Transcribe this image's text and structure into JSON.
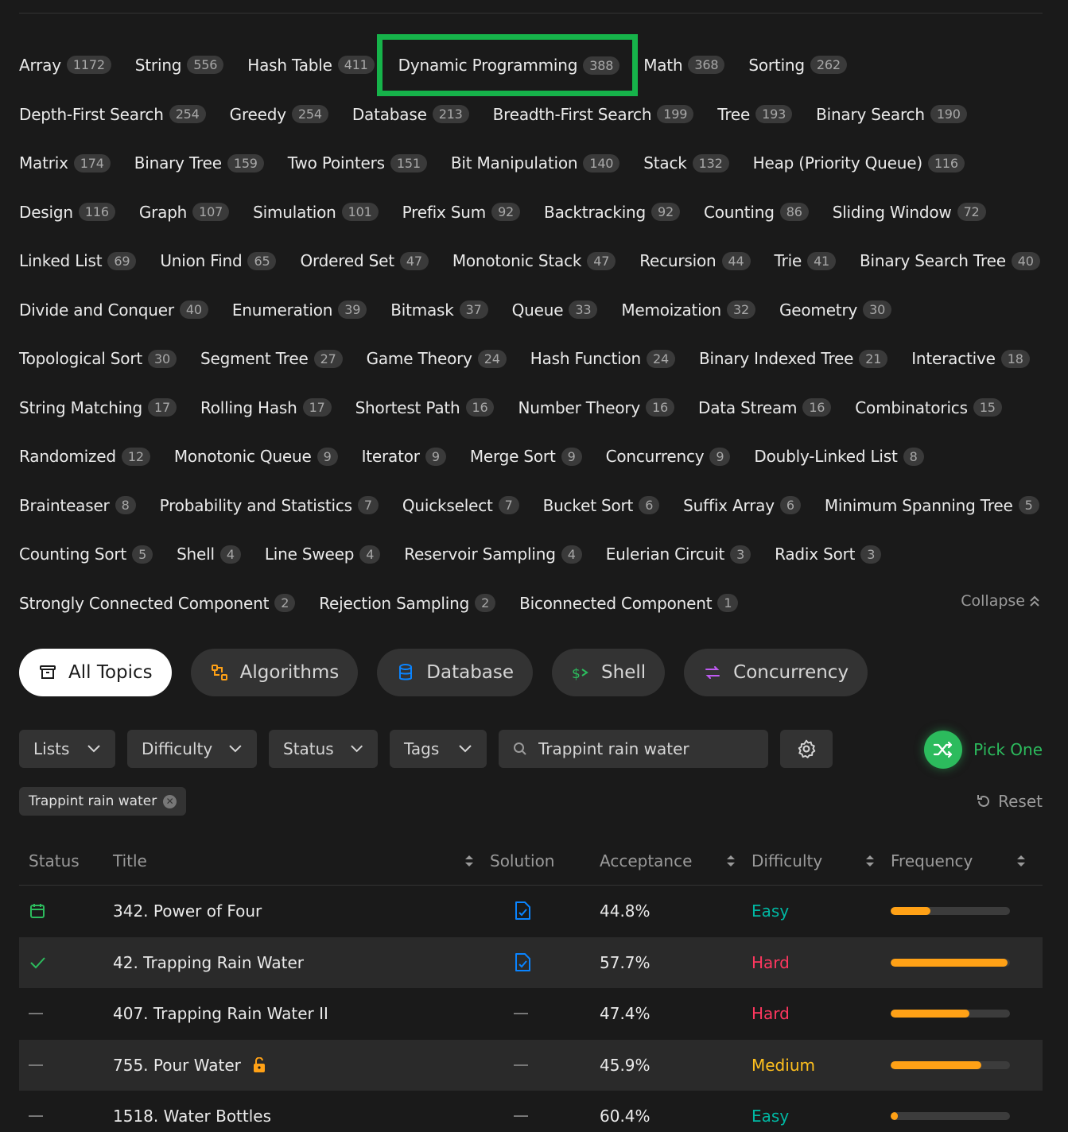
{
  "topics": [
    {
      "name": "Array",
      "count": "1172"
    },
    {
      "name": "String",
      "count": "556"
    },
    {
      "name": "Hash Table",
      "count": "411"
    },
    {
      "name": "Dynamic Programming",
      "count": "388",
      "highlighted": true
    },
    {
      "name": "Math",
      "count": "368"
    },
    {
      "name": "Sorting",
      "count": "262"
    },
    {
      "name": "Depth-First Search",
      "count": "254"
    },
    {
      "name": "Greedy",
      "count": "254"
    },
    {
      "name": "Database",
      "count": "213"
    },
    {
      "name": "Breadth-First Search",
      "count": "199"
    },
    {
      "name": "Tree",
      "count": "193"
    },
    {
      "name": "Binary Search",
      "count": "190"
    },
    {
      "name": "Matrix",
      "count": "174"
    },
    {
      "name": "Binary Tree",
      "count": "159"
    },
    {
      "name": "Two Pointers",
      "count": "151"
    },
    {
      "name": "Bit Manipulation",
      "count": "140"
    },
    {
      "name": "Stack",
      "count": "132"
    },
    {
      "name": "Heap (Priority Queue)",
      "count": "116"
    },
    {
      "name": "Design",
      "count": "116"
    },
    {
      "name": "Graph",
      "count": "107"
    },
    {
      "name": "Simulation",
      "count": "101"
    },
    {
      "name": "Prefix Sum",
      "count": "92"
    },
    {
      "name": "Backtracking",
      "count": "92"
    },
    {
      "name": "Counting",
      "count": "86"
    },
    {
      "name": "Sliding Window",
      "count": "72"
    },
    {
      "name": "Linked List",
      "count": "69"
    },
    {
      "name": "Union Find",
      "count": "65"
    },
    {
      "name": "Ordered Set",
      "count": "47"
    },
    {
      "name": "Monotonic Stack",
      "count": "47"
    },
    {
      "name": "Recursion",
      "count": "44"
    },
    {
      "name": "Trie",
      "count": "41"
    },
    {
      "name": "Binary Search Tree",
      "count": "40"
    },
    {
      "name": "Divide and Conquer",
      "count": "40"
    },
    {
      "name": "Enumeration",
      "count": "39"
    },
    {
      "name": "Bitmask",
      "count": "37"
    },
    {
      "name": "Queue",
      "count": "33"
    },
    {
      "name": "Memoization",
      "count": "32"
    },
    {
      "name": "Geometry",
      "count": "30"
    },
    {
      "name": "Topological Sort",
      "count": "30"
    },
    {
      "name": "Segment Tree",
      "count": "27"
    },
    {
      "name": "Game Theory",
      "count": "24"
    },
    {
      "name": "Hash Function",
      "count": "24"
    },
    {
      "name": "Binary Indexed Tree",
      "count": "21"
    },
    {
      "name": "Interactive",
      "count": "18"
    },
    {
      "name": "String Matching",
      "count": "17"
    },
    {
      "name": "Rolling Hash",
      "count": "17"
    },
    {
      "name": "Shortest Path",
      "count": "16"
    },
    {
      "name": "Number Theory",
      "count": "16"
    },
    {
      "name": "Data Stream",
      "count": "16"
    },
    {
      "name": "Combinatorics",
      "count": "15"
    },
    {
      "name": "Randomized",
      "count": "12"
    },
    {
      "name": "Monotonic Queue",
      "count": "9"
    },
    {
      "name": "Iterator",
      "count": "9"
    },
    {
      "name": "Merge Sort",
      "count": "9"
    },
    {
      "name": "Concurrency",
      "count": "9"
    },
    {
      "name": "Doubly-Linked List",
      "count": "8"
    },
    {
      "name": "Brainteaser",
      "count": "8"
    },
    {
      "name": "Probability and Statistics",
      "count": "7"
    },
    {
      "name": "Quickselect",
      "count": "7"
    },
    {
      "name": "Bucket Sort",
      "count": "6"
    },
    {
      "name": "Suffix Array",
      "count": "6"
    },
    {
      "name": "Minimum Spanning Tree",
      "count": "5"
    },
    {
      "name": "Counting Sort",
      "count": "5"
    },
    {
      "name": "Shell",
      "count": "4"
    },
    {
      "name": "Line Sweep",
      "count": "4"
    },
    {
      "name": "Reservoir Sampling",
      "count": "4"
    },
    {
      "name": "Eulerian Circuit",
      "count": "3"
    },
    {
      "name": "Radix Sort",
      "count": "3"
    },
    {
      "name": "Strongly Connected Component",
      "count": "2"
    },
    {
      "name": "Rejection Sampling",
      "count": "2"
    },
    {
      "name": "Biconnected Component",
      "count": "1"
    }
  ],
  "collapse_label": "Collapse",
  "categories": [
    {
      "label": "All Topics",
      "icon": "archive-icon",
      "active": true
    },
    {
      "label": "Algorithms",
      "icon": "algorithm-icon",
      "color": "#ffa116"
    },
    {
      "label": "Database",
      "icon": "database-icon",
      "color": "#0a84ff"
    },
    {
      "label": "Shell",
      "icon": "terminal-icon",
      "color": "#2cbb5d"
    },
    {
      "label": "Concurrency",
      "icon": "concurrency-icon",
      "color": "#bf5af2"
    }
  ],
  "filters": {
    "lists": "Lists",
    "difficulty": "Difficulty",
    "status": "Status",
    "tags": "Tags",
    "search_value": "Trappint rain water"
  },
  "pick_one": "Pick One",
  "active_chip": "Trappint rain water",
  "reset": "Reset",
  "table": {
    "headers": {
      "status": "Status",
      "title": "Title",
      "solution": "Solution",
      "acceptance": "Acceptance",
      "difficulty": "Difficulty",
      "frequency": "Frequency"
    },
    "rows": [
      {
        "status": "calendar",
        "title": "342. Power of Four",
        "solution": true,
        "acceptance": "44.8%",
        "difficulty": "Easy",
        "frequency": 0.33,
        "locked": false
      },
      {
        "status": "solved",
        "title": "42. Trapping Rain Water",
        "solution": true,
        "acceptance": "57.7%",
        "difficulty": "Hard",
        "frequency": 0.98,
        "locked": false
      },
      {
        "status": "none",
        "title": "407. Trapping Rain Water II",
        "solution": false,
        "acceptance": "47.4%",
        "difficulty": "Hard",
        "frequency": 0.66,
        "locked": false
      },
      {
        "status": "none",
        "title": "755. Pour Water",
        "solution": false,
        "acceptance": "45.9%",
        "difficulty": "Medium",
        "frequency": 0.76,
        "locked": true
      },
      {
        "status": "none",
        "title": "1518. Water Bottles",
        "solution": false,
        "acceptance": "60.4%",
        "difficulty": "Easy",
        "frequency": 0.06,
        "locked": false
      }
    ]
  },
  "colors": {
    "accent_green": "#2cbb5d",
    "highlight_outline": "#16b34a",
    "easy": "#00b8a3",
    "medium": "#ffc01e",
    "hard": "#ff375f",
    "frequency": "#ffa116"
  }
}
